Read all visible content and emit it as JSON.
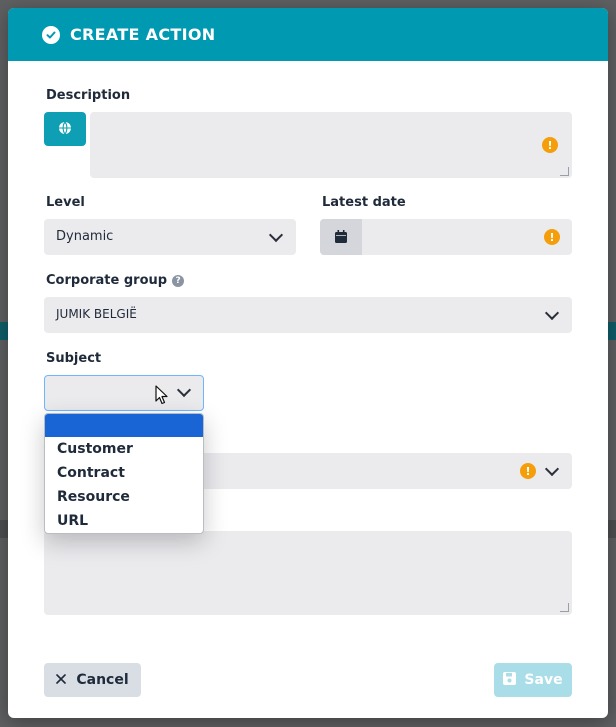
{
  "modal": {
    "title": "CREATE ACTION"
  },
  "form": {
    "description_label": "Description",
    "level_label": "Level",
    "level_value": "Dynamic",
    "latest_date_label": "Latest date",
    "corporate_group_label": "Corporate group",
    "corporate_group_value": "JUMIK BELGIË",
    "subject_label": "Subject",
    "subject_value": ""
  },
  "subject_dropdown": {
    "options": [
      "",
      "Customer",
      "Contract",
      "Resource",
      "URL"
    ],
    "highlighted_index": 0
  },
  "footer": {
    "cancel_label": "Cancel",
    "save_label": "Save"
  },
  "icons": {
    "header": "check-circle-icon",
    "description_lang": "globe-icon",
    "warning": "warning-icon",
    "date": "calendar-icon",
    "help": "help-icon",
    "cancel": "close-icon",
    "save": "floppy-disk-icon"
  },
  "colors": {
    "accent": "#0099b2",
    "warning": "#f59e0b",
    "selection": "#1a65d6",
    "save_disabled": "#a9dde7"
  }
}
